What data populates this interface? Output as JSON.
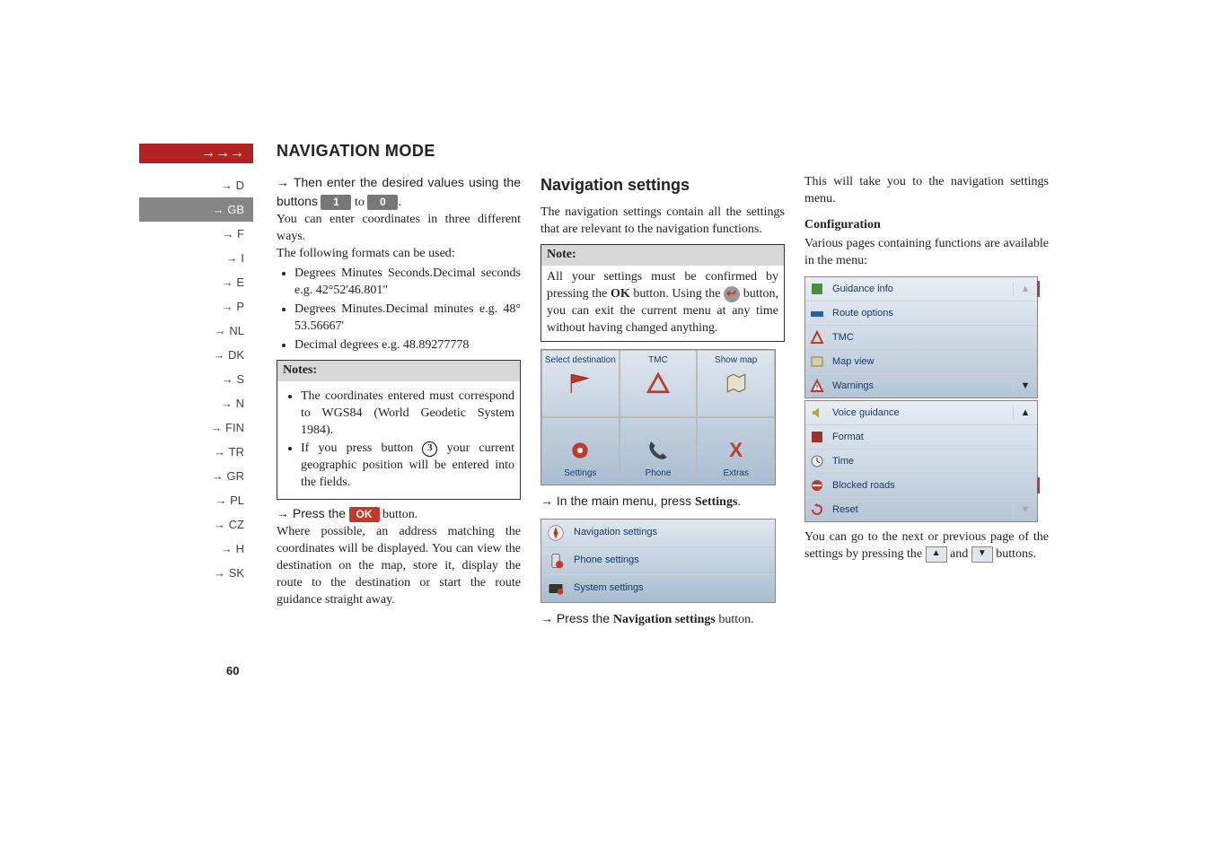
{
  "header": {
    "arrow": "→→→",
    "title": "NAVIGATION MODE"
  },
  "sidebar": {
    "items": [
      {
        "code": "→ D"
      },
      {
        "code": "→ GB"
      },
      {
        "code": "→ F"
      },
      {
        "code": "→ I"
      },
      {
        "code": "→ E"
      },
      {
        "code": "→ P"
      },
      {
        "code": "→ NL"
      },
      {
        "code": "→ DK"
      },
      {
        "code": "→ S"
      },
      {
        "code": "→ N"
      },
      {
        "code": "→ FIN"
      },
      {
        "code": "→ TR"
      },
      {
        "code": "→ GR"
      },
      {
        "code": "→ PL"
      },
      {
        "code": "→ CZ"
      },
      {
        "code": "→ H"
      },
      {
        "code": "→ SK"
      }
    ],
    "activeIndex": 1
  },
  "col1": {
    "p1_prefix": "→ Then enter the desired values using the buttons",
    "btn1": "1",
    "to": "to",
    "btn0": "0",
    "p1_suffix": ".",
    "p2": "You can enter coordinates in three different ways.",
    "p3": "The following formats can be used:",
    "bullets1": [
      "Degrees Minutes Seconds.Decimal seconds e.g. 42°52'46.801\"",
      "Degrees Minutes.Decimal minutes e.g. 48° 53.56667'",
      "Decimal degrees e.g. 48.89277778"
    ],
    "notes_title": "Notes:",
    "notes_b1": "The coordinates entered must correspond to WGS84 (World Geodetic System 1984).",
    "notes_b2_prefix": "If you press button",
    "notes_b2_num": "3",
    "notes_b2_suffix": "your current geographic position will be entered into the fields.",
    "press_prefix": "→ Press the",
    "ok_btn": "OK",
    "press_suffix": "button.",
    "p4": "Where possible, an address matching the coordinates will be displayed. You can view the destination on the map, store it, display the route to the destination or start the route guidance straight away."
  },
  "col2": {
    "h2": "Navigation settings",
    "p1": "The navigation settings contain all the settings that are relevant to the navigation functions.",
    "note_title": "Note:",
    "note_body_1": "All your settings must be confirmed by pressing the ",
    "note_ok": "OK",
    "note_body_2": " button. Using the ",
    "note_body_3": " button, you can exit the current menu at any time without having changed anything.",
    "mainmenu": {
      "cells": [
        {
          "label": "Select destination"
        },
        {
          "label": "TMC"
        },
        {
          "label": "Show map"
        },
        {
          "label": "Settings"
        },
        {
          "label": "Phone"
        },
        {
          "label": "Extras"
        }
      ]
    },
    "step1_prefix": "→ In the main menu, press ",
    "step1_bold": "Settings",
    "step1_suffix": ".",
    "submenu": {
      "rows": [
        "Navigation settings",
        "Phone settings",
        "System settings"
      ]
    },
    "step2_prefix": "→ Press the ",
    "step2_bold": "Navigation settings",
    "step2_suffix": " button."
  },
  "col3": {
    "p1": "This will take you to the navigation settings menu.",
    "h3": "Configuration",
    "p2": "Various pages containing functions are available in the menu:",
    "config_group1": [
      {
        "label": "Guidance info",
        "scroll": "▲"
      },
      {
        "label": "Route options"
      },
      {
        "label": "TMC"
      },
      {
        "label": "Map view"
      },
      {
        "label": "Warnings",
        "scroll": "▼"
      }
    ],
    "config_group2": [
      {
        "label": "Voice guidance",
        "scroll": "▲"
      },
      {
        "label": "Format"
      },
      {
        "label": "Time"
      },
      {
        "label": "Blocked roads"
      },
      {
        "label": "Reset",
        "scroll": "▼"
      }
    ],
    "p3_prefix": "You can go to the next or previous page of the settings by pressing the",
    "up": "▲",
    "and": "and",
    "down": "▼",
    "p3_suffix": "buttons."
  },
  "page_number": "60"
}
